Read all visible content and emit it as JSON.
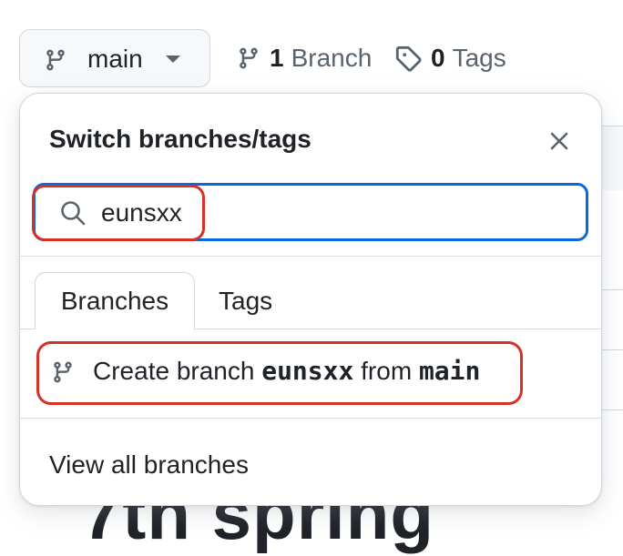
{
  "toolbar": {
    "branch_button_label": "main",
    "branch_count": "1",
    "branch_label": "Branch",
    "tag_count": "0",
    "tag_label": "Tags"
  },
  "background": {
    "partial_heading": "7th  spring"
  },
  "popover": {
    "title": "Switch branches/tags",
    "close_icon": "close-icon",
    "search": {
      "value": "eunsxx",
      "icon": "search-icon"
    },
    "tabs": [
      {
        "label": "Branches",
        "selected": true
      },
      {
        "label": "Tags",
        "selected": false
      }
    ],
    "create_branch": {
      "prefix": "Create branch ",
      "name": "eunsxx",
      "middle": " from ",
      "source": "main"
    },
    "view_all": "View all branches"
  },
  "colors": {
    "accent_focus": "#0969da",
    "highlight_annotation": "#d93025",
    "muted_text": "#59636e",
    "border": "#d0d7de"
  }
}
